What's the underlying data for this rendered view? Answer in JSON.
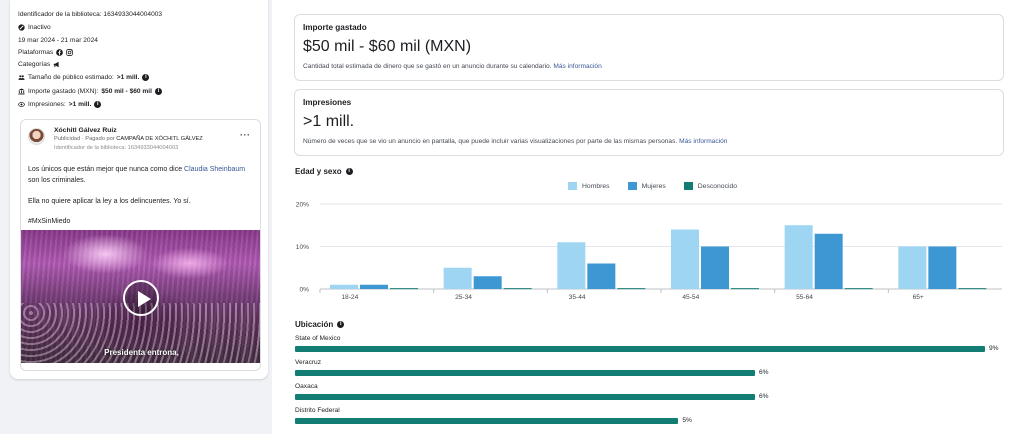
{
  "colors": {
    "hombres": "#9dd5f3",
    "mujeres": "#3d97d3",
    "desconocido": "#127d73",
    "link": "#385898"
  },
  "left": {
    "library_id": "Identificador de la biblioteca: 1634933044004003",
    "status": "Inactivo",
    "status_icon": "slash-circle-icon",
    "dates": "19 mar 2024 - 21 mar 2024",
    "platforms_label": "Plataformas",
    "platform_icons": [
      "facebook-icon",
      "instagram-icon"
    ],
    "categories_label": "Categorías",
    "categories_icon": "megaphone-icon",
    "audience_label": "Tamaño de público estimado: ",
    "audience_value": ">1 mill.",
    "spend_label": "Importe gastado (MXN): ",
    "spend_value": "$50 mil - $60 mil",
    "impressions_label": "Impresiones: ",
    "impressions_value": ">1 mill.",
    "ad": {
      "advertiser": "Xóchitl Gálvez Ruiz",
      "sponsored_prefix": "Publicidad · Pagado por ",
      "sponsored_by": "CAMPAÑA DE XÓCHITL GÁLVEZ",
      "id": "Identificador de la biblioteca: 1634933044004003",
      "more": "···",
      "text_1_before": "Los únicos que están mejor que nunca como dice ",
      "text_1_link": "Claudia Sheinbaum",
      "text_1_after": " son los criminales.",
      "text_2": "Ella no quiere aplicar la ley a los delincuentes. Yo sí.",
      "text_3": "#MxSinMiedo",
      "video_caption": "Presidenta entrona,"
    }
  },
  "spend_card": {
    "title": "Importe gastado",
    "value": "$50 mil - $60 mil (MXN)",
    "description": "Cantidad total estimada de dinero que se gastó en un anuncio durante su calendario.",
    "link": "Más información"
  },
  "impressions_card": {
    "title": "Impresiones",
    "value": ">1 mill.",
    "description": "Número de veces que se vio un anuncio en pantalla, que puede incluir varias visualizaciones por parte de las mismas personas.",
    "link": "Más información"
  },
  "age_section_title": "Edad y sexo",
  "chart_data": {
    "type": "bar",
    "categories": [
      "18-24",
      "25-34",
      "35-44",
      "45-54",
      "55-64",
      "65+"
    ],
    "series": [
      {
        "name": "Hombres",
        "values": [
          1,
          5,
          11,
          14,
          15,
          10
        ]
      },
      {
        "name": "Mujeres",
        "values": [
          1,
          3,
          6,
          10,
          13,
          10
        ]
      },
      {
        "name": "Desconocido",
        "values": [
          0.2,
          0.2,
          0.2,
          0.2,
          0.2,
          0.2
        ]
      }
    ],
    "ylim": [
      0,
      20
    ],
    "yticks": [
      "0%",
      "10%",
      "20%"
    ],
    "grid": true,
    "legend": "top-center"
  },
  "location_section_title": "Ubicación",
  "locations": [
    {
      "name": "State of Mexico",
      "pct_label": "9%",
      "value": 9
    },
    {
      "name": "Veracruz",
      "pct_label": "6%",
      "value": 6
    },
    {
      "name": "Oaxaca",
      "pct_label": "6%",
      "value": 6
    },
    {
      "name": "Distrito Federal",
      "pct_label": "5%",
      "value": 5
    }
  ]
}
